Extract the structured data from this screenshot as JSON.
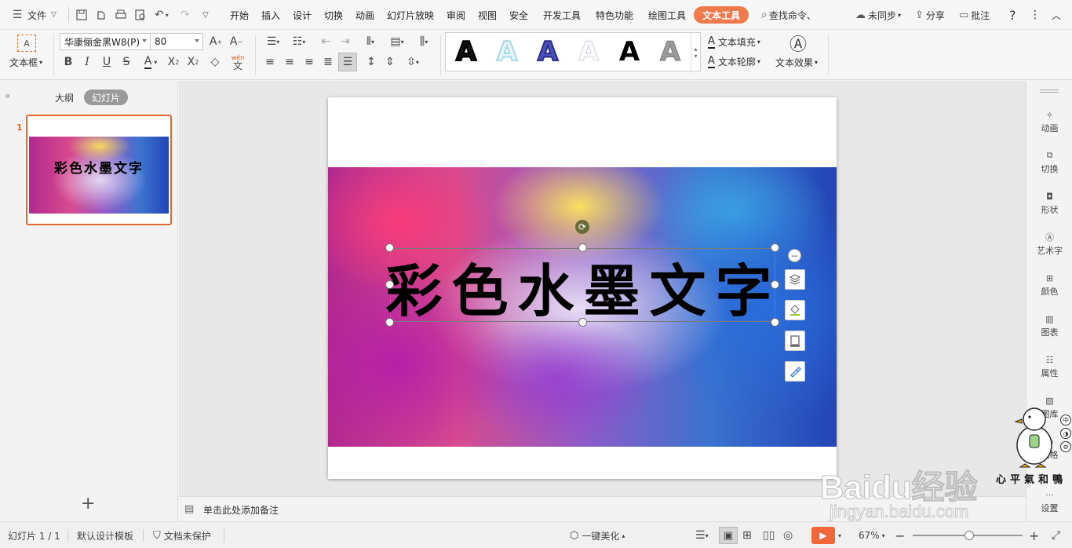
{
  "menubar": {
    "file_label": "文件",
    "tabs": [
      "开始",
      "插入",
      "设计",
      "切换",
      "动画",
      "幻灯片放映",
      "审阅",
      "视图",
      "安全",
      "开发工具",
      "特色功能",
      "绘图工具",
      "文本工具"
    ],
    "active_tab": "文本工具",
    "search_label": "查找命令、",
    "sync_label": "未同步",
    "share_label": "分享",
    "comment_label": "批注",
    "help_label": "?"
  },
  "ribbon": {
    "textbox_label": "文本框",
    "font_name": "华康俪金黑W8(P)",
    "font_size": "80",
    "phonetic_glyph": "wén",
    "phonetic_char": "文",
    "text_fill_label": "文本填充",
    "text_outline_label": "文本轮廓",
    "text_effect_label": "文本效果",
    "art_letter": "A"
  },
  "leftpanel": {
    "tab_outline": "大纲",
    "tab_slides": "幻灯片",
    "slide_number": "1",
    "thumb_text": "彩色水墨文字",
    "add_slide": "+"
  },
  "slide": {
    "title_text": "彩色水墨文字"
  },
  "notes": {
    "placeholder": "单击此处添加备注"
  },
  "rightpanel": {
    "items": [
      "动画",
      "切换",
      "形状",
      "艺术字",
      "颜色",
      "图表",
      "属性",
      "图库",
      "风格",
      "设置"
    ]
  },
  "statusbar": {
    "slide_count": "幻灯片 1 / 1",
    "template": "默认设计模板",
    "protection": "文档未保护",
    "beautify": "一键美化",
    "zoom": "67%",
    "zoom_value": 0.67
  },
  "watermark": {
    "brand": "Baidu经验",
    "url": "jingyan.baidu.com",
    "sticker_text": "心平氣和鴨"
  },
  "colors": {
    "accent": "#f07a4b",
    "slide_border": "#e06a2c",
    "play": "#f0683a"
  }
}
